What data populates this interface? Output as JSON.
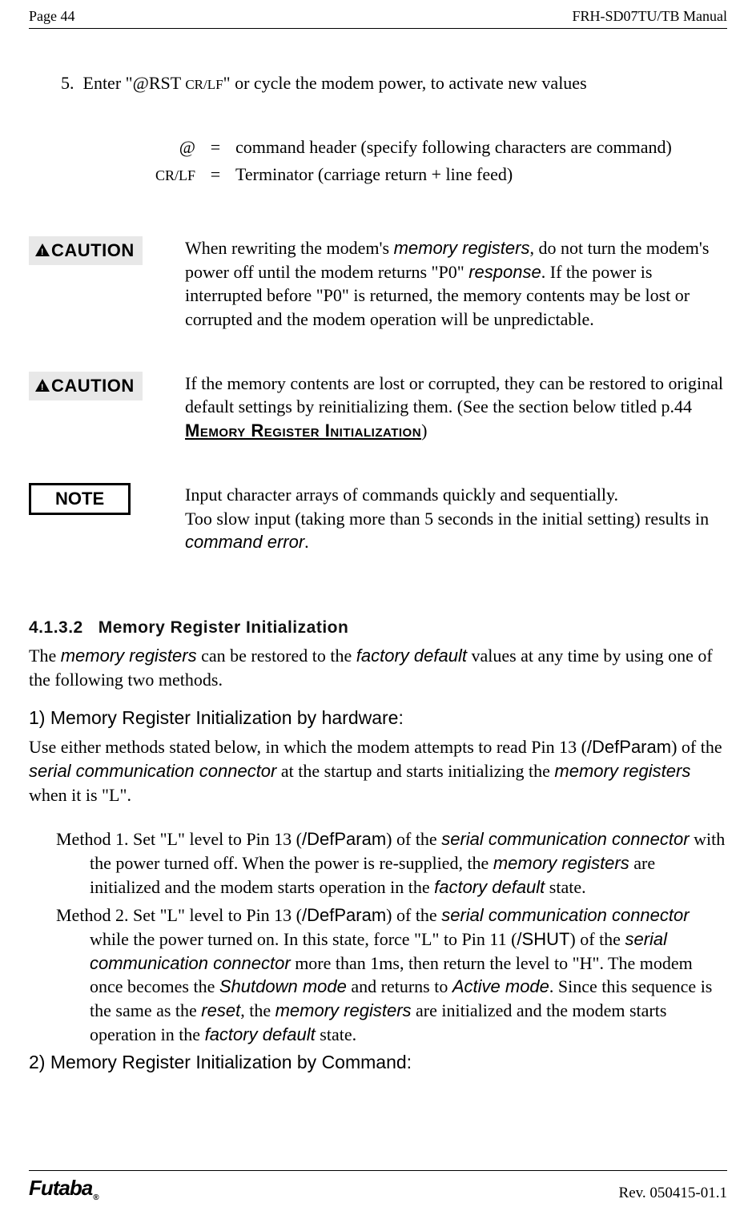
{
  "header": {
    "page_label": "Page  44",
    "doc_title": "FRH-SD07TU/TB Manual"
  },
  "step5": {
    "num": "5.",
    "text_a": "Enter \"",
    "rst": "@RST ",
    "crlf": "CR/LF",
    "text_b": "\" or cycle the modem power, to activate new values"
  },
  "cmd_defs": {
    "at": {
      "key": "@",
      "eq": "=",
      "val": "command header (specify following characters are command)"
    },
    "crlf": {
      "key": "CR/LF",
      "eq": "=",
      "val": "Terminator (carriage return + line feed)"
    }
  },
  "caution1": {
    "label": "CAUTION",
    "t1": "When rewriting the modem's ",
    "t2": "memory registers",
    "t3": ", do not turn the modem's power off until the modem returns \"P0\" ",
    "t4": "response",
    "t5": ". If the power is interrupted before \"P0\" is returned, the memory contents may be lost or corrupted and the modem operation will be unpredictable."
  },
  "caution2": {
    "label": "CAUTION",
    "t1": "If the memory contents are lost or corrupted, they can be restored to original default settings by reinitializing them. (See the section below titled p.44 ",
    "link": "Memory Register Initialization",
    "t2": ")"
  },
  "note": {
    "label": "NOTE",
    "t1": "Input character arrays of commands quickly and sequentially.",
    "t2a": "Too slow input (taking more than 5 seconds in the initial setting) results in ",
    "t2b": "command error",
    "t2c": "."
  },
  "sec_num": "4.1.3.2",
  "sec_title": "Memory Register Initialization",
  "intro": {
    "a": "The ",
    "b": "memory registers",
    "c": " can be restored to the ",
    "d": "factory default",
    "e": " values at any time by using one of the following two methods."
  },
  "sub1": "1) Memory Register Initialization by hardware:",
  "sub1_para": {
    "a": "Use either methods stated below, in which the modem attempts to read Pin 13 (",
    "b": "/DefParam",
    "c": ") of the ",
    "d": "serial communication connector",
    "e": " at the startup and starts initializing the ",
    "f": "memory registers",
    "g": " when it is \"L\"."
  },
  "method1": {
    "label": "Method 1.  ",
    "a": "Set \"L\" level to Pin 13 (",
    "b": "/DefParam",
    "c": ") of the ",
    "d": "serial communication connector",
    "e": "  with the power turned off. When the power is re-supplied, the ",
    "f": "memory registers",
    "g": " are initialized and the modem starts operation in the ",
    "h": "factory default",
    "i": " state."
  },
  "method2": {
    "label": "Method 2. ",
    "a": "Set \"L\" level to Pin 13 (",
    "b": "/DefParam",
    "c": ") of the ",
    "d": "serial communication connector",
    "e": " while the power turned on. In this state, force \"L\" to Pin 11 (",
    "f": "/SHUT",
    "g": ") of the ",
    "h": "serial communication connector",
    "i": " more than 1ms, then return the level to \"H\". The modem once becomes the ",
    "j": "Shutdown mode",
    "k": " and returns to ",
    "l": "Active mode",
    "m": ". Since this sequence is the same as the ",
    "n": "reset",
    "o": ", the ",
    "p": "memory registers",
    "q": " are initialized and the modem starts operation in the ",
    "r": "factory default",
    "s": " state."
  },
  "sub2": "2) Memory Register Initialization by Command:",
  "footer": {
    "brand": "Futaba",
    "reg": "®",
    "rev": "Rev. 050415-01.1"
  }
}
